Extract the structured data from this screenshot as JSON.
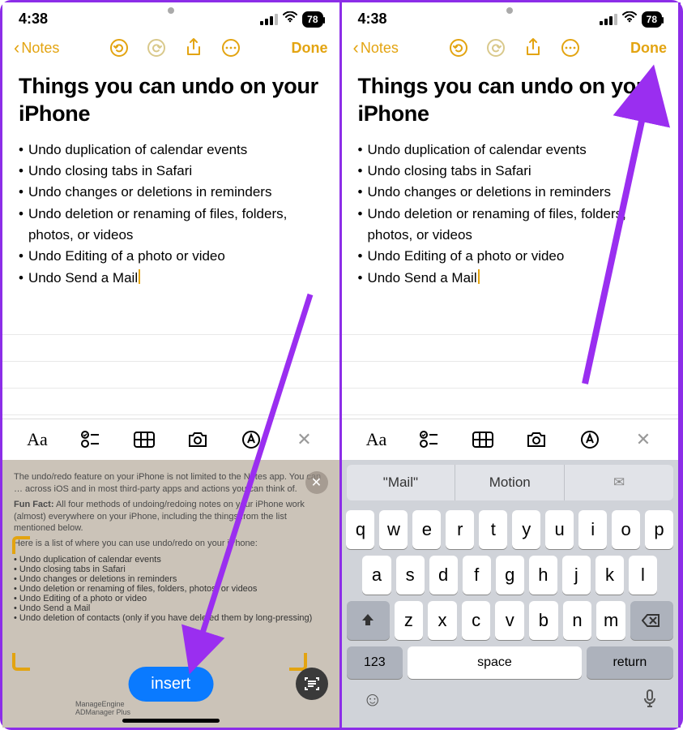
{
  "status": {
    "time": "4:38",
    "battery": "78"
  },
  "nav": {
    "back": "Notes",
    "done": "Done"
  },
  "note": {
    "title": "Things you can undo on your iPhone",
    "items": [
      "Undo duplication of calendar events",
      "Undo closing tabs in Safari",
      "Undo changes or deletions in reminders",
      "Undo deletion or renaming of files, folders, photos, or videos",
      "Undo Editing of a photo or video",
      "Undo Send a Mail"
    ]
  },
  "scan": {
    "intro": "The undo/redo feature on your iPhone is not limited to the Notes app. You can … across iOS and in most third-party apps and actions you can think of.",
    "fact_label": "Fun Fact:",
    "fact": "All four methods of undoing/redoing notes on your iPhone work (almost) everywhere on your iPhone, including the things from the list mentioned below.",
    "list_intro": "Here is a list of where you can use undo/redo on your iPhone:",
    "items": [
      "Undo duplication of calendar events",
      "Undo closing tabs in Safari",
      "Undo changes or deletions in reminders",
      "Undo deletion or renaming of files, folders, photos, or videos",
      "Undo Editing of a photo or video",
      "Undo Send a Mail",
      "Undo deletion of contacts (only if you have deleted them by long-pressing)"
    ],
    "insert": "insert",
    "ad1": "ManageEngine",
    "ad2": "ADManager Plus"
  },
  "kb": {
    "suggest": [
      "\"Mail\"",
      "Motion",
      ""
    ],
    "rows": [
      [
        "q",
        "w",
        "e",
        "r",
        "t",
        "y",
        "u",
        "i",
        "o",
        "p"
      ],
      [
        "a",
        "s",
        "d",
        "f",
        "g",
        "h",
        "j",
        "k",
        "l"
      ],
      [
        "z",
        "x",
        "c",
        "v",
        "b",
        "n",
        "m"
      ]
    ],
    "num": "123",
    "space": "space",
    "return": "return"
  }
}
